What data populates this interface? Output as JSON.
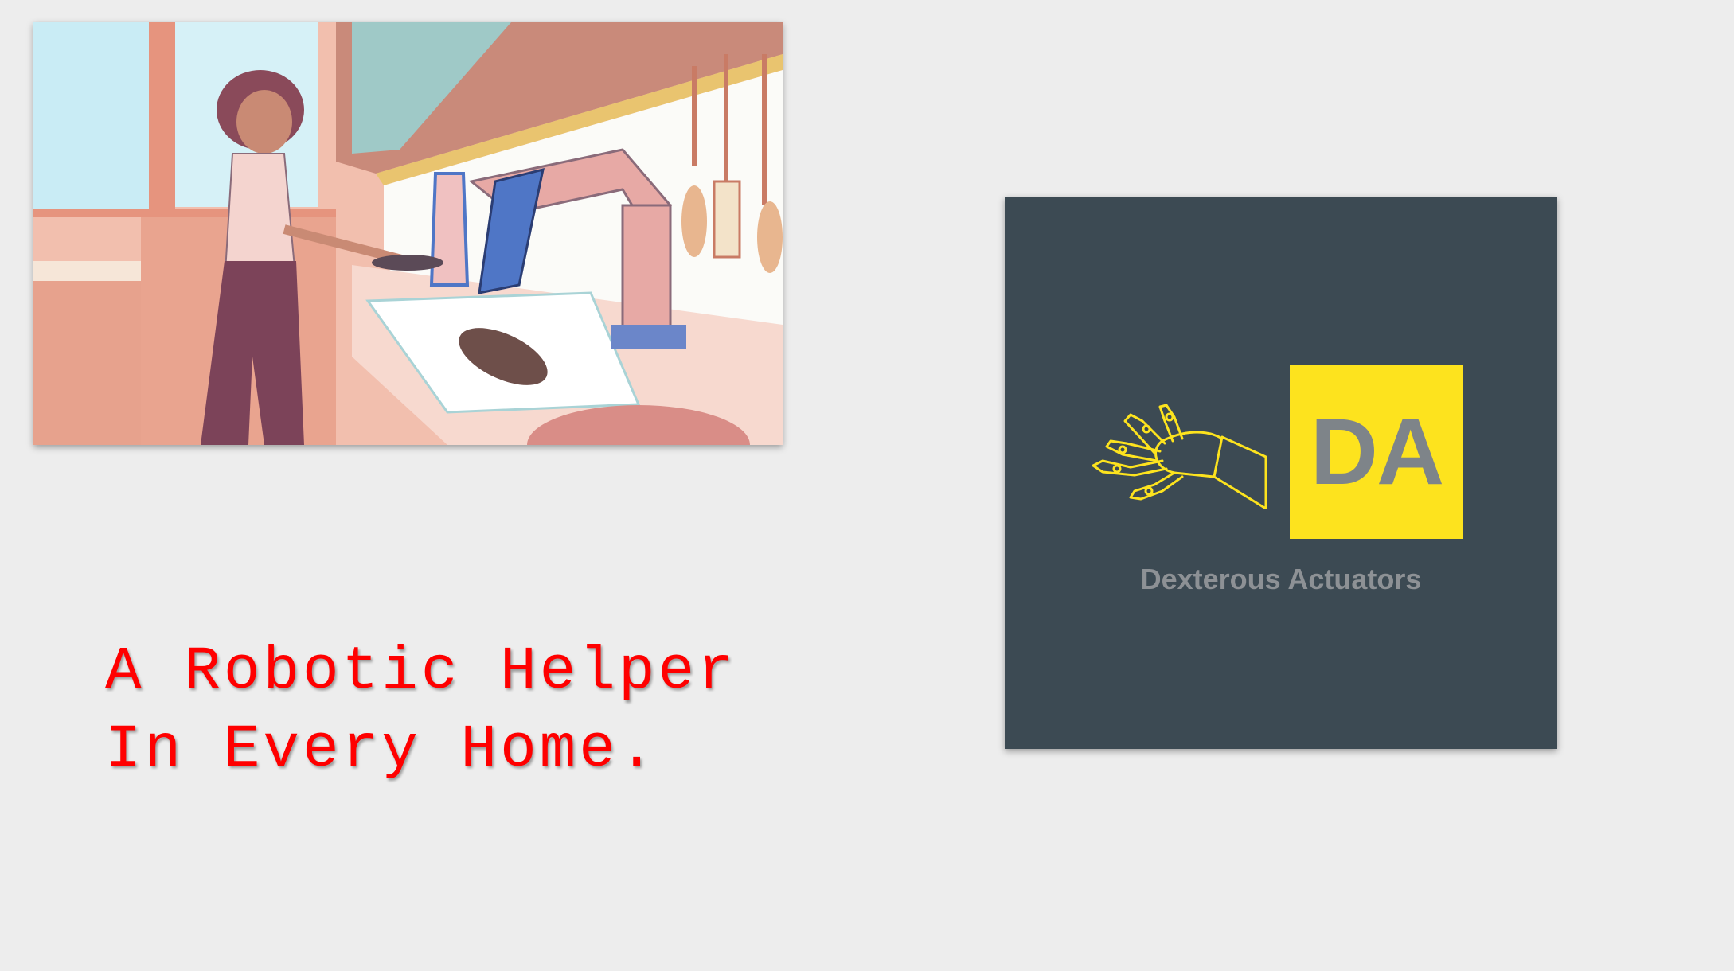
{
  "illustration": {
    "alt": "Illustration of a woman cooking while a robotic arm chops in a kitchen"
  },
  "tagline": {
    "line1": "A Robotic Helper",
    "line2": "In Every Home."
  },
  "logo": {
    "monogram": "DA",
    "name": "Dexterous Actuators",
    "colors": {
      "background": "#3c4a53",
      "accent": "#fde31e",
      "text": "#8d9195"
    },
    "icon": "robot-hand-icon"
  }
}
